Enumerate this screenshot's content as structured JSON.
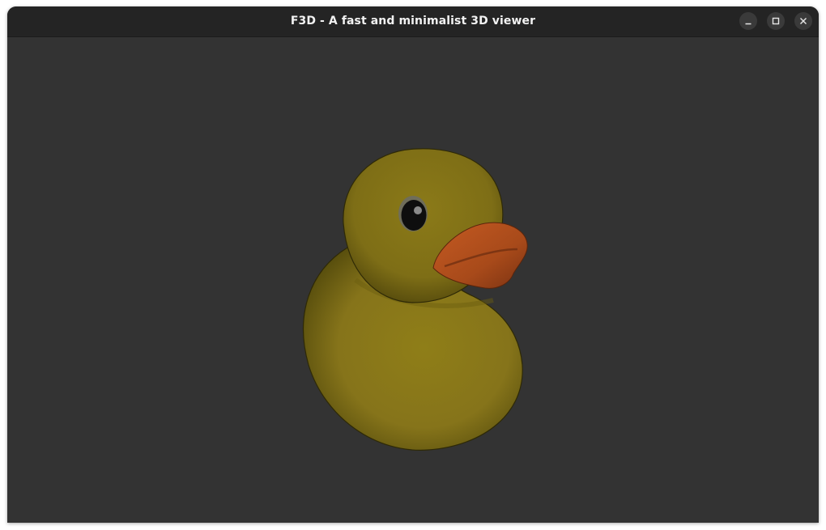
{
  "window": {
    "title": "F3D - A fast and minimalist 3D viewer",
    "controls": {
      "minimize_icon": "minimize-icon",
      "maximize_icon": "maximize-icon",
      "close_icon": "close-icon"
    }
  },
  "viewport": {
    "background_color": "#333333",
    "model": "rubber-duck",
    "model_colors": {
      "body": "#8f7d16",
      "beak": "#b6501d",
      "eye": "#0d0d0d"
    }
  }
}
